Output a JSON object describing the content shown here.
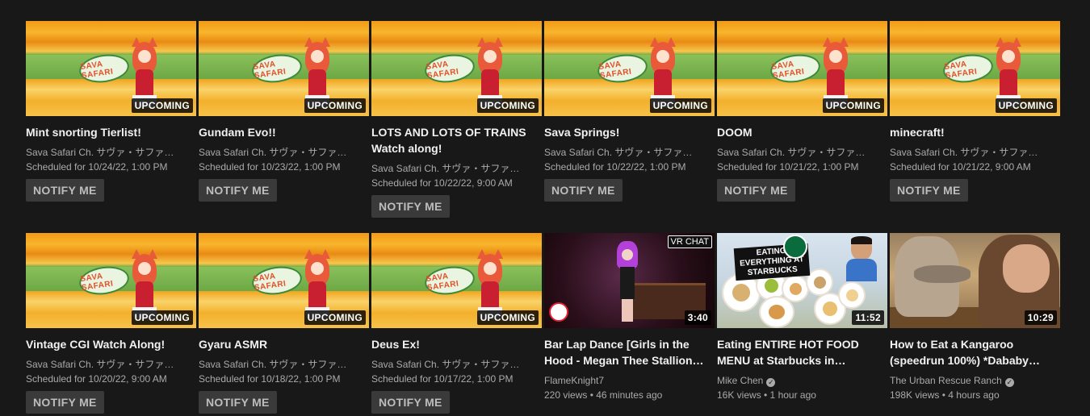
{
  "badges": {
    "upcoming": "UPCOMING",
    "vrchat": "VR CHAT"
  },
  "notify_label": "NOTIFY ME",
  "thumb_text": {
    "sava_logo": "SAVA SAFARI",
    "starbucks_overlay": "EATING EVERYTHING AT STARBUCKS"
  },
  "row1": [
    {
      "title": "Mint snorting Tierlist!",
      "channel": "Sava Safari Ch. サヴァ・サファ…",
      "meta": "Scheduled for 10/24/22, 1:00 PM"
    },
    {
      "title": "Gundam Evo!!",
      "channel": "Sava Safari Ch. サヴァ・サファ…",
      "meta": "Scheduled for 10/23/22, 1:00 PM"
    },
    {
      "title": "LOTS AND LOTS OF TRAINS Watch along!",
      "channel": "Sava Safari Ch. サヴァ・サファ…",
      "meta": "Scheduled for 10/22/22, 9:00 AM"
    },
    {
      "title": "Sava Springs!",
      "channel": "Sava Safari Ch. サヴァ・サファ…",
      "meta": "Scheduled for 10/22/22, 1:00 PM"
    },
    {
      "title": "DOOM",
      "channel": "Sava Safari Ch. サヴァ・サファ…",
      "meta": "Scheduled for 10/21/22, 1:00 PM"
    },
    {
      "title": "minecraft!",
      "channel": "Sava Safari Ch. サヴァ・サファ…",
      "meta": "Scheduled for 10/21/22, 9:00 AM"
    }
  ],
  "row2": [
    {
      "title": "Vintage CGI Watch Along!",
      "channel": "Sava Safari Ch. サヴァ・サファ…",
      "meta": "Scheduled for 10/20/22, 9:00 AM"
    },
    {
      "title": "Gyaru ASMR",
      "channel": "Sava Safari Ch. サヴァ・サファ…",
      "meta": "Scheduled for 10/18/22, 1:00 PM"
    },
    {
      "title": "Deus Ex!",
      "channel": "Sava Safari Ch. サヴァ・サファ…",
      "meta": "Scheduled for 10/17/22, 1:00 PM"
    },
    {
      "title": "Bar Lap Dance [Girls in the Hood - Megan Thee Stallion…",
      "channel": "FlameKnight7",
      "meta": "220 views • 46 minutes ago",
      "duration": "3:40"
    },
    {
      "title": "Eating ENTIRE HOT FOOD MENU at Starbucks in…",
      "channel": "Mike Chen",
      "meta": "16K views • 1 hour ago",
      "duration": "11:52",
      "verified": "✓"
    },
    {
      "title": "How to Eat a Kangaroo (speedrun 100%) *Dababy…",
      "channel": "The Urban Rescue Ranch",
      "meta": "198K views • 4 hours ago",
      "duration": "10:29",
      "verified": "✓"
    }
  ]
}
